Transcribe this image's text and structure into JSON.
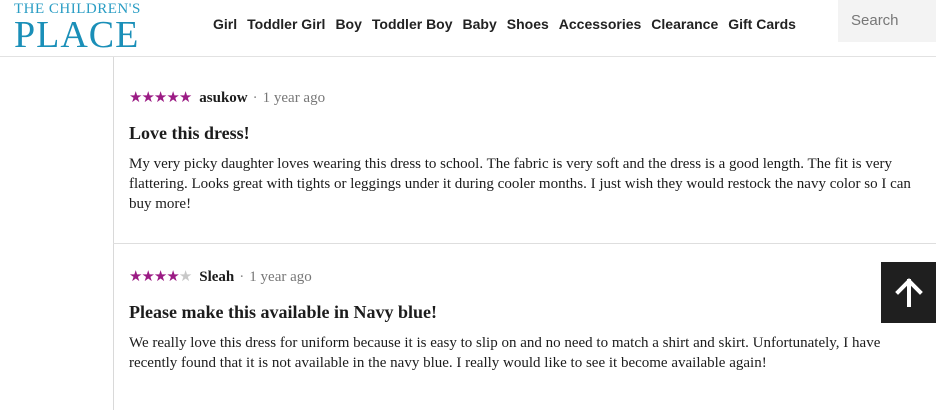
{
  "brand": {
    "line1": "THE CHILDREN'S",
    "line2": "PLACE"
  },
  "nav": {
    "items": [
      "Girl",
      "Toddler Girl",
      "Boy",
      "Toddler Boy",
      "Baby",
      "Shoes",
      "Accessories",
      "Clearance",
      "Gift Cards"
    ]
  },
  "search": {
    "placeholder": "Search"
  },
  "reviews": [
    {
      "rating": 5,
      "author": "asukow",
      "separator": "·",
      "age": "1 year ago",
      "title": "Love this dress!",
      "body": "My very picky daughter loves wearing this dress to school. The fabric is very soft and the dress is a good length. The fit is very flattering. Looks great with tights or leggings under it during cooler months. I just wish they would restock the navy color so I can buy more!"
    },
    {
      "rating": 4,
      "author": "Sleah",
      "separator": "·",
      "age": "1 year ago",
      "title": "Please make this available in Navy blue!",
      "body": "We really love this dress for uniform because it is easy to slip on and no need to match a shirt and skirt. Unfortunately, I have recently found that it is not available in the navy blue. I really would like to see it become available again!"
    }
  ],
  "colors": {
    "brand": "#1a8fb8",
    "star_filled": "#9b1b84",
    "star_empty": "#c8c8c8"
  },
  "icons": {
    "scroll_top": "arrow-up-icon",
    "star": "star-icon"
  }
}
